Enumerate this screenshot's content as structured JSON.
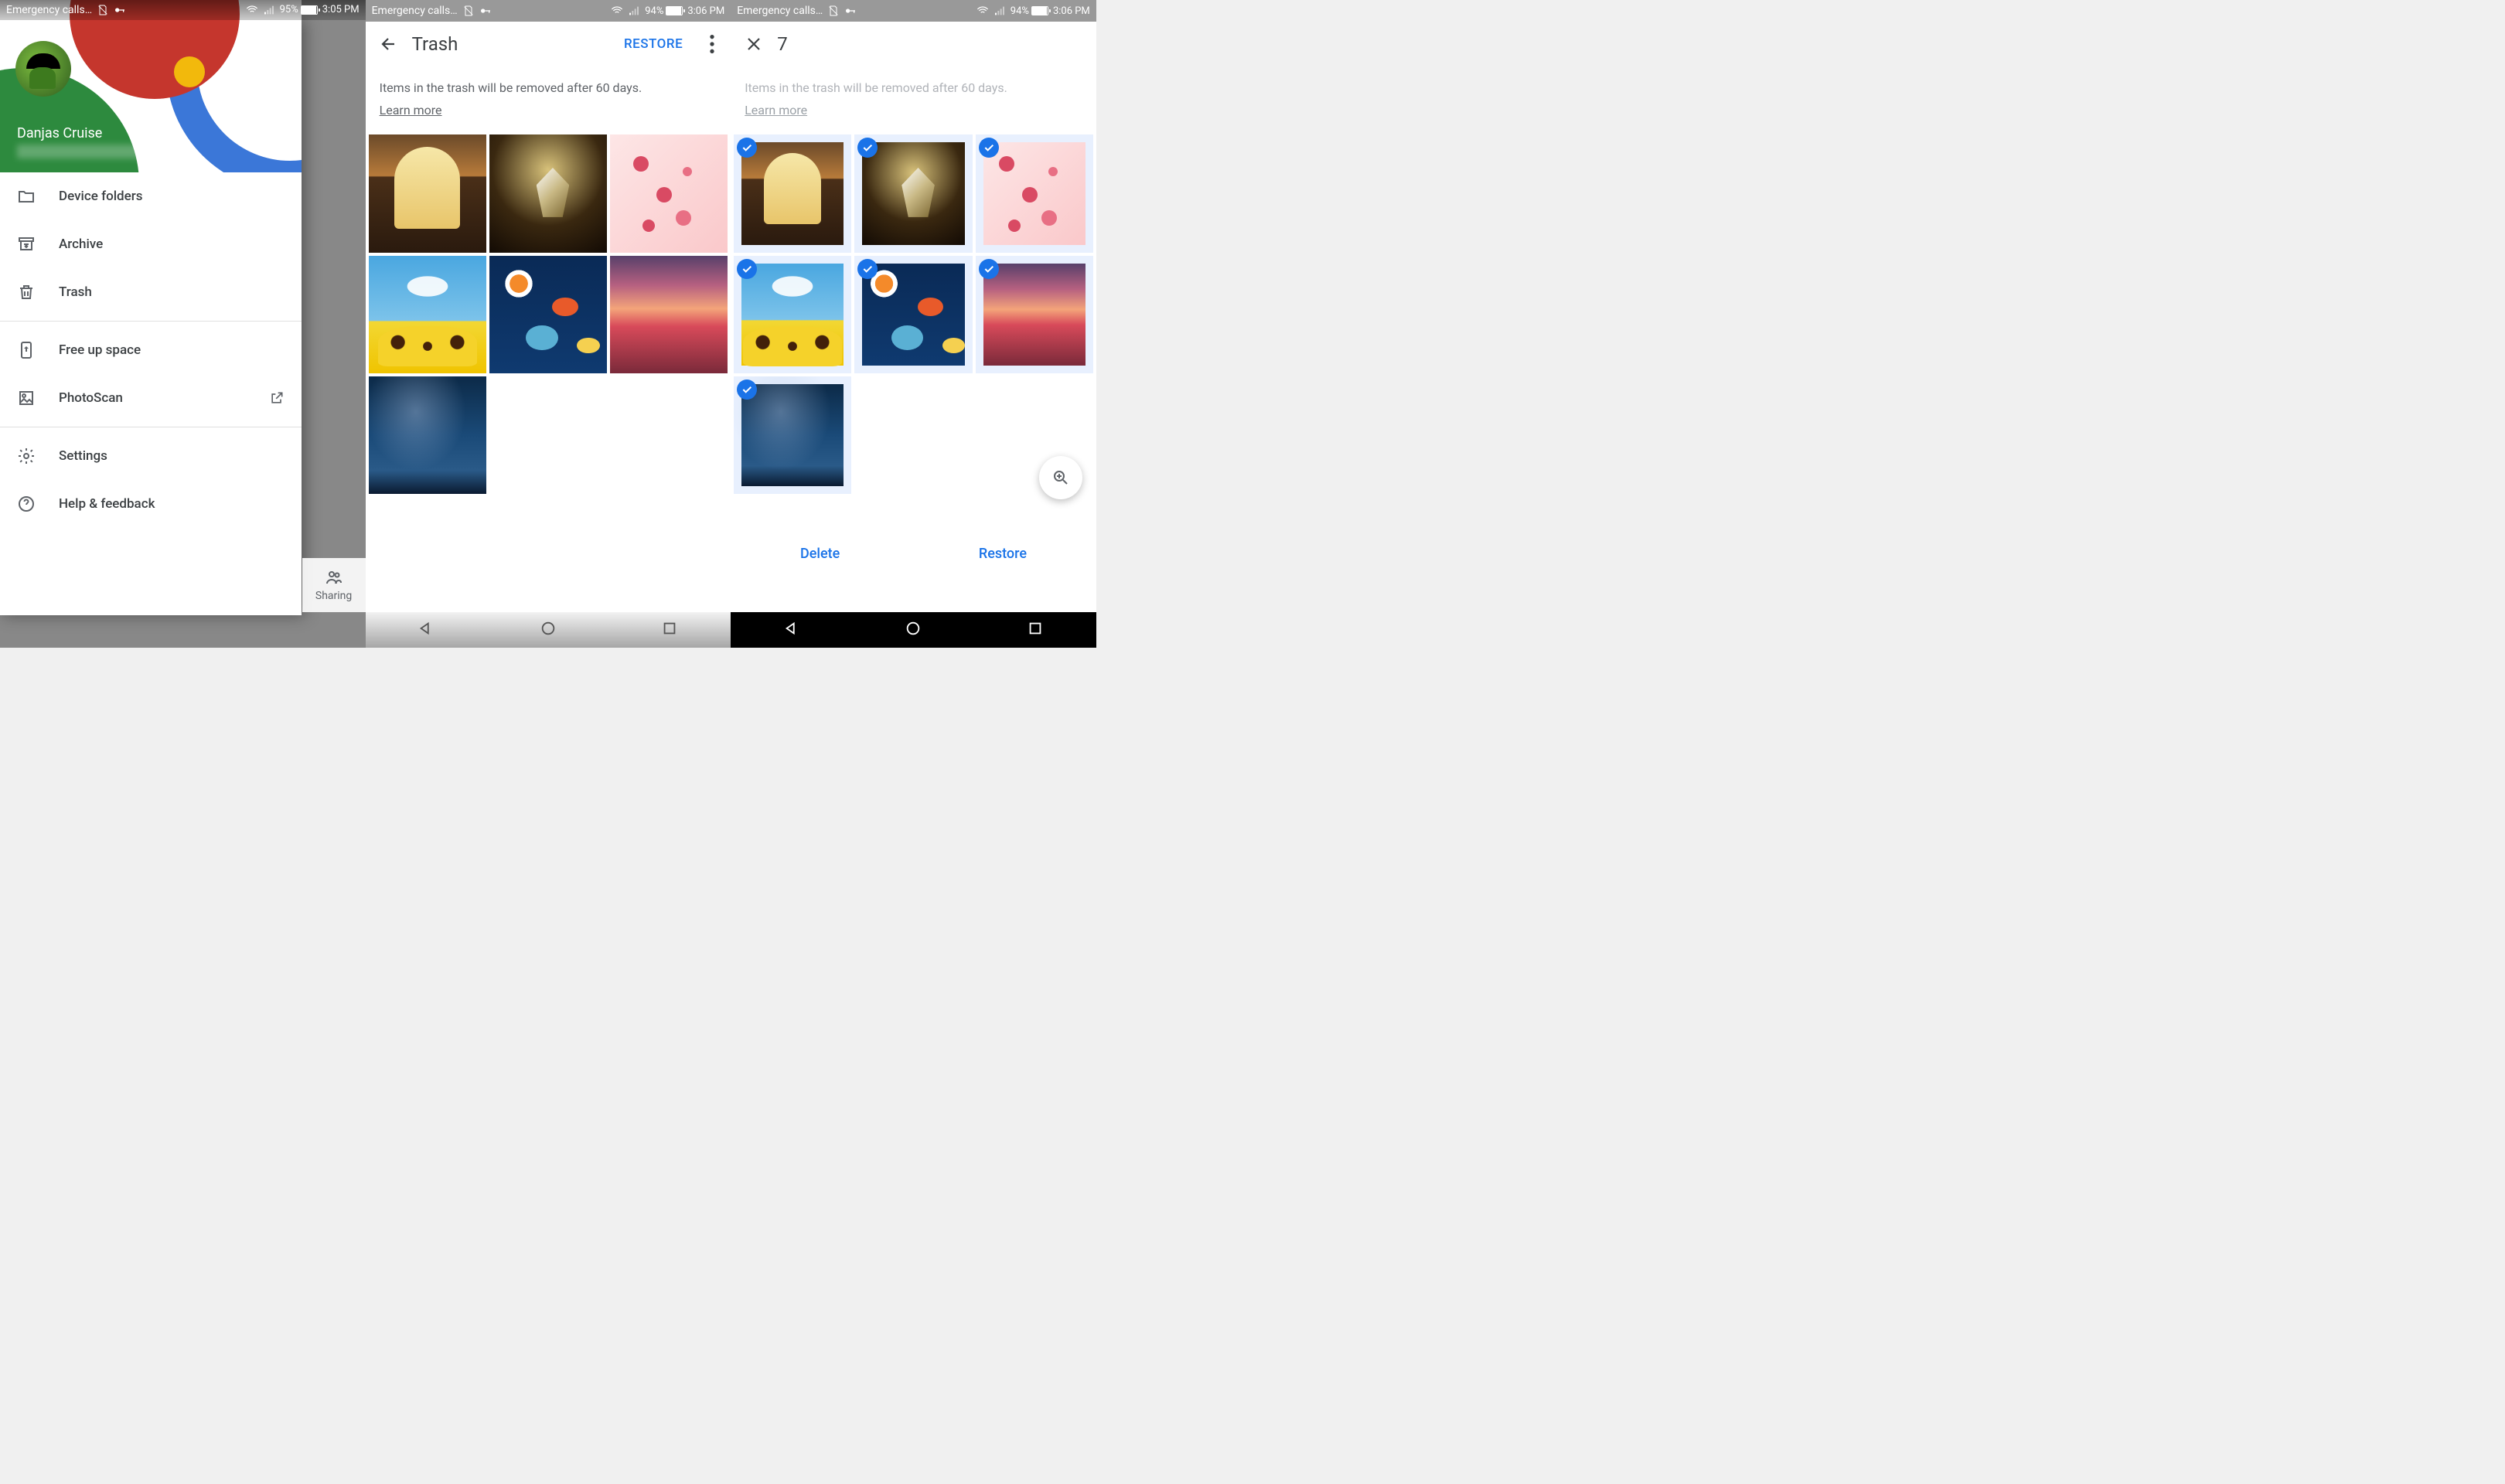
{
  "phone1": {
    "status": {
      "carrier": "Emergency calls…",
      "battery": "95%",
      "time": "3:05 PM"
    },
    "user": {
      "name": "Danjas Cruise"
    },
    "menu": {
      "device_folders": "Device folders",
      "archive": "Archive",
      "trash": "Trash",
      "free_up": "Free up space",
      "photoscan": "PhotoScan",
      "settings": "Settings",
      "help": "Help & feedback"
    },
    "sharing_tab": "Sharing"
  },
  "phone2": {
    "status": {
      "carrier": "Emergency calls…",
      "battery": "94%",
      "time": "3:06 PM"
    },
    "title": "Trash",
    "restore": "RESTORE",
    "notice": "Items in the trash will be removed after 60 days.",
    "learn_more": "Learn more"
  },
  "phone3": {
    "status": {
      "carrier": "Emergency calls…",
      "battery": "94%",
      "time": "3:06 PM"
    },
    "count": "7",
    "notice": "Items in the trash will be removed after 60 days.",
    "learn_more": "Learn more",
    "delete": "Delete",
    "restore": "Restore"
  }
}
